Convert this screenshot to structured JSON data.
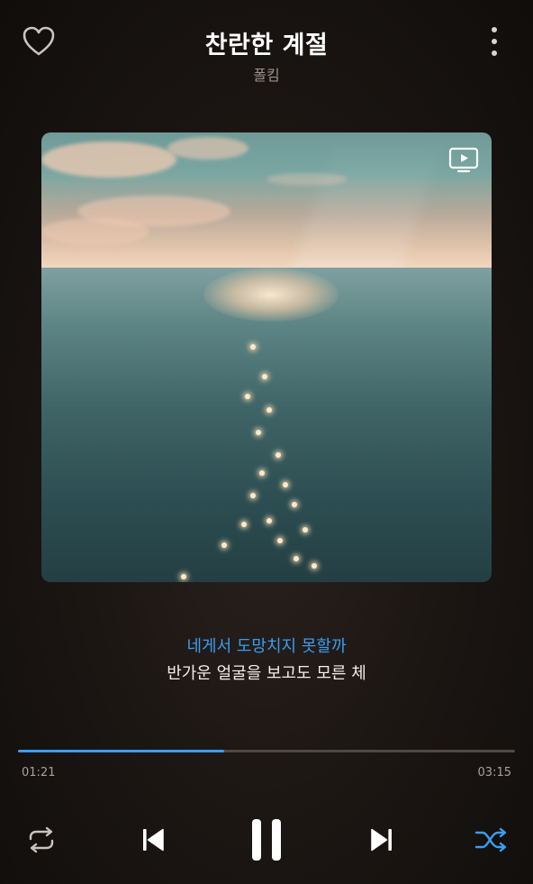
{
  "header": {
    "title": "찬란한 계절",
    "artist": "폴킴",
    "like_icon": "heart-outline-icon",
    "more_icon": "more-vertical-icon"
  },
  "artwork": {
    "overlay_icon": "tv-play-icon"
  },
  "lyrics": {
    "current": "네게서 도망치지 못할까",
    "next": "반가운 얼굴을 보고도 모른 체"
  },
  "playback": {
    "elapsed": "01:21",
    "duration": "03:15",
    "progress_fraction": 0.415
  },
  "controls": {
    "repeat_icon": "repeat-icon",
    "previous_icon": "skip-previous-icon",
    "pause_icon": "pause-icon",
    "next_icon": "skip-next-icon",
    "shuffle_icon": "shuffle-icon"
  },
  "colors": {
    "accent": "#3b9df2",
    "background": "#1a1512",
    "secondary_text": "#9a928c"
  }
}
